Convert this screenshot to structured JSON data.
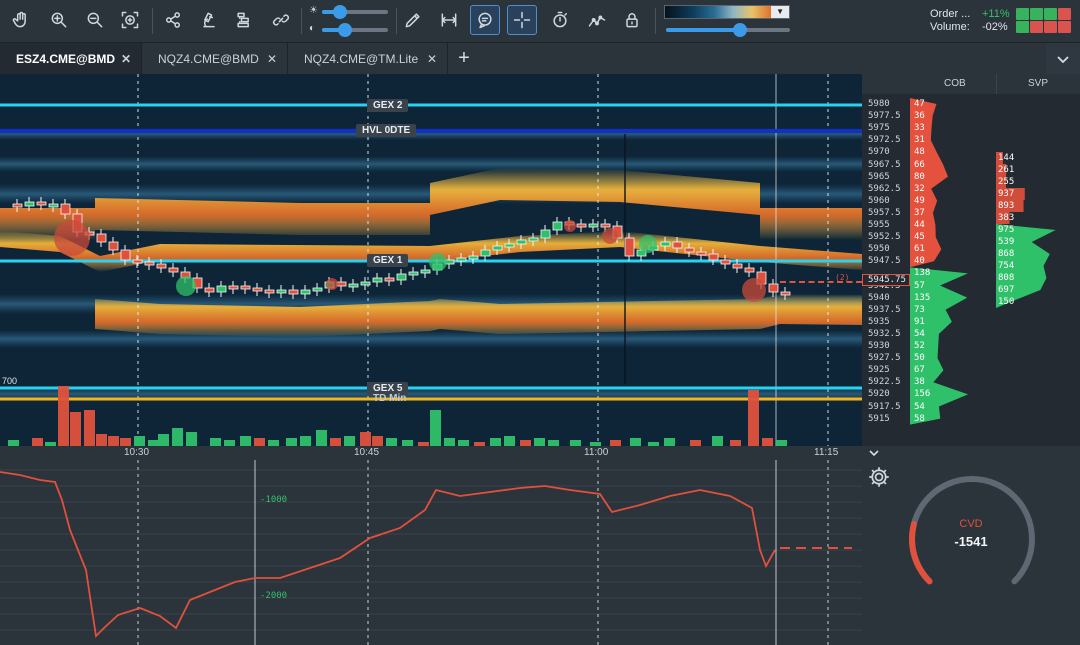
{
  "toolbar": {
    "tools": [
      {
        "name": "hand-icon"
      },
      {
        "name": "zoom-in-icon"
      },
      {
        "name": "zoom-out-icon"
      },
      {
        "name": "zoom-fit-icon"
      },
      {
        "name": "share-icon"
      },
      {
        "name": "microscope-icon"
      },
      {
        "name": "layers-icon"
      },
      {
        "name": "link-icon"
      },
      {
        "name": "pencil-icon"
      },
      {
        "name": "measure-icon"
      },
      {
        "name": "chat-icon"
      },
      {
        "name": "crosshair-icon"
      },
      {
        "name": "timer-icon"
      },
      {
        "name": "indicator-icon"
      },
      {
        "name": "lock-icon"
      }
    ],
    "brightness_level": 0.28,
    "contrast_level": 0.35,
    "heatmap_range_level": 0.6,
    "accent": "#3b9be8"
  },
  "market_context": {
    "order_label": "Order ...",
    "order_value": "+11%",
    "volume_label": "Volume:",
    "volume_value": "-02%",
    "cells": [
      "#36b35c",
      "#36b35c",
      "#36b35c",
      "#d9534f",
      "#36b35c",
      "#d9534f",
      "#d9534f",
      "#d9534f"
    ]
  },
  "tabs": [
    {
      "label": "ESZ4.CME@BMD",
      "active": true
    },
    {
      "label": "NQZ4.CME@BMD",
      "active": false
    },
    {
      "label": "NQZ4.CME@TM.Lite",
      "active": false
    }
  ],
  "add_tab_label": "+",
  "panel_headers": {
    "cob": "COB",
    "svp": "SVP"
  },
  "levels": {
    "gex2": "GEX 2",
    "hvl": "HVL 0DTE",
    "gex1": "GEX 1",
    "gex5": "GEX 5",
    "td_min": "TD Min",
    "volume_scale": "700"
  },
  "time_axis": [
    "10:30",
    "10:45",
    "11:00",
    "11:15"
  ],
  "current_price": "5945.75",
  "current_price_tag": "(2)",
  "cob": [
    {
      "price": "5980",
      "size": "47",
      "side": "ask"
    },
    {
      "price": "5977.5",
      "size": "36",
      "side": "ask"
    },
    {
      "price": "5975",
      "size": "33",
      "side": "ask"
    },
    {
      "price": "5972.5",
      "size": "31",
      "side": "ask"
    },
    {
      "price": "5970",
      "size": "48",
      "side": "ask"
    },
    {
      "price": "5967.5",
      "size": "66",
      "side": "ask"
    },
    {
      "price": "5965",
      "size": "80",
      "side": "ask"
    },
    {
      "price": "5962.5",
      "size": "32",
      "side": "ask"
    },
    {
      "price": "5960",
      "size": "49",
      "side": "ask"
    },
    {
      "price": "5957.5",
      "size": "37",
      "side": "ask"
    },
    {
      "price": "5955",
      "size": "44",
      "side": "ask"
    },
    {
      "price": "5952.5",
      "size": "45",
      "side": "ask"
    },
    {
      "price": "5950",
      "size": "61",
      "side": "ask"
    },
    {
      "price": "5947.5",
      "size": "40",
      "side": "ask"
    },
    {
      "price": "",
      "size": "138",
      "side": "bid"
    },
    {
      "price": "5942.5",
      "size": "57",
      "side": "bid"
    },
    {
      "price": "5940",
      "size": "135",
      "side": "bid"
    },
    {
      "price": "5937.5",
      "size": "73",
      "side": "bid"
    },
    {
      "price": "5935",
      "size": "91",
      "side": "bid"
    },
    {
      "price": "5932.5",
      "size": "54",
      "side": "bid"
    },
    {
      "price": "5930",
      "size": "52",
      "side": "bid"
    },
    {
      "price": "5927.5",
      "size": "50",
      "side": "bid"
    },
    {
      "price": "5925",
      "size": "67",
      "side": "bid"
    },
    {
      "price": "5922.5",
      "size": "38",
      "side": "bid"
    },
    {
      "price": "5920",
      "size": "156",
      "side": "bid"
    },
    {
      "price": "5917.5",
      "size": "54",
      "side": "bid"
    },
    {
      "price": "5915",
      "size": "58",
      "side": "bid"
    }
  ],
  "svp": [
    "144",
    "261",
    "255",
    "937",
    "893",
    "383",
    "975",
    "539",
    "868",
    "754",
    "808",
    "697",
    "150"
  ],
  "cvd": {
    "label": "CVD",
    "value": "-1541",
    "scale": [
      "-1000",
      "-2000"
    ],
    "gauge_fraction": 0.22
  },
  "colors": {
    "ask": "#e4513d",
    "bid": "#2fc16a",
    "level_cyan": "#27d3f0",
    "level_blue": "#1230c8",
    "level_yellow": "#f2b51c",
    "cvd_line": "#e0513d"
  }
}
